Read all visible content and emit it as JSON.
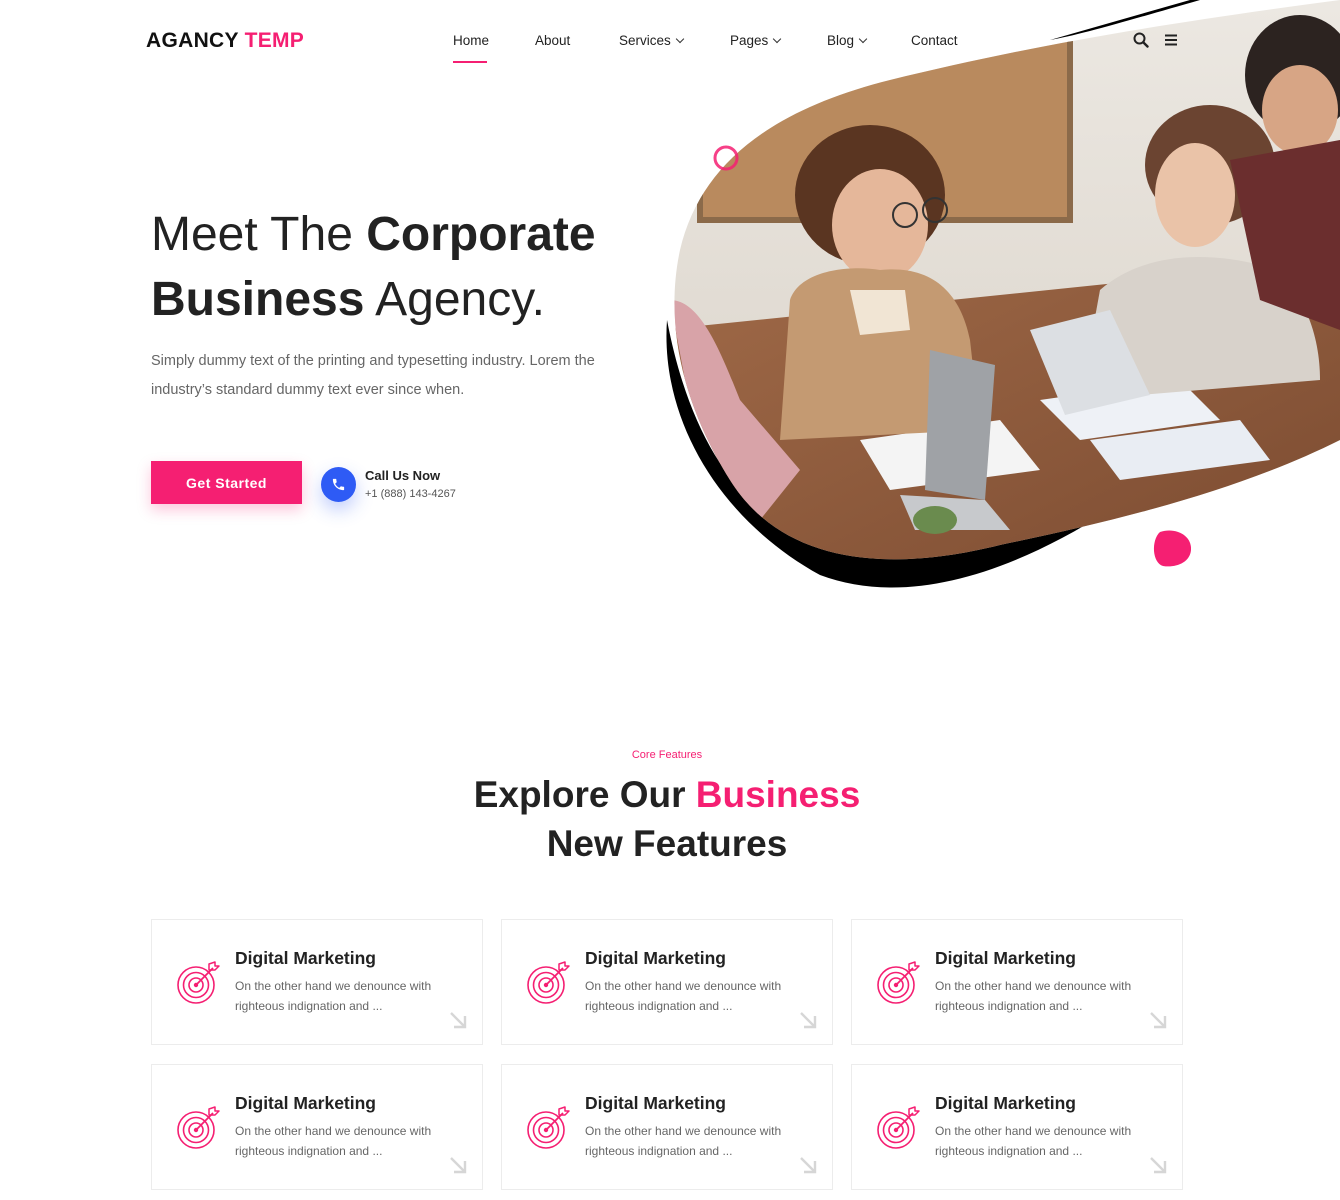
{
  "header": {
    "logo_main": "AGANCY",
    "logo_accent": "TEMP",
    "nav": [
      {
        "label": "Home",
        "has_dropdown": false,
        "active": true
      },
      {
        "label": "About",
        "has_dropdown": false,
        "active": false
      },
      {
        "label": "Services",
        "has_dropdown": true,
        "active": false
      },
      {
        "label": "Pages",
        "has_dropdown": true,
        "active": false
      },
      {
        "label": "Blog",
        "has_dropdown": true,
        "active": false
      },
      {
        "label": "Contact",
        "has_dropdown": false,
        "active": false
      }
    ],
    "icons": [
      "search-icon",
      "menu-icon"
    ]
  },
  "hero": {
    "title_normal_1": "Meet The",
    "title_bold_1": "Corporate",
    "title_bold_2": "Business",
    "title_normal_2": "Agency.",
    "description": "Simply dummy text of the printing and typesetting industry. Lorem the industry’s standard dummy text ever since when.",
    "cta_label": "Get Started",
    "call_title": "Call Us Now",
    "call_phone": "+1 (888) 143-4267"
  },
  "features": {
    "label": "Core Features",
    "title_part_1": "Explore Our",
    "title_accent": "Business",
    "title_part_2": "New Features",
    "cards": [
      {
        "title": "Digital Marketing",
        "text": "On the other hand we denounce with righteous indignation and ..."
      },
      {
        "title": "Digital Marketing",
        "text": "On the other hand we denounce with righteous indignation and ..."
      },
      {
        "title": "Digital Marketing",
        "text": "On the other hand we denounce with righteous indignation and ..."
      },
      {
        "title": "Digital Marketing",
        "text": "On the other hand we denounce with righteous indignation and ..."
      },
      {
        "title": "Digital Marketing",
        "text": "On the other hand we denounce with righteous indignation and ..."
      },
      {
        "title": "Digital Marketing",
        "text": "On the other hand we denounce with righteous indignation and ..."
      }
    ]
  },
  "colors": {
    "accent": "#f51f72",
    "call_blue": "#2e5bf5",
    "text_dark": "#222222",
    "text_muted": "#666666"
  }
}
